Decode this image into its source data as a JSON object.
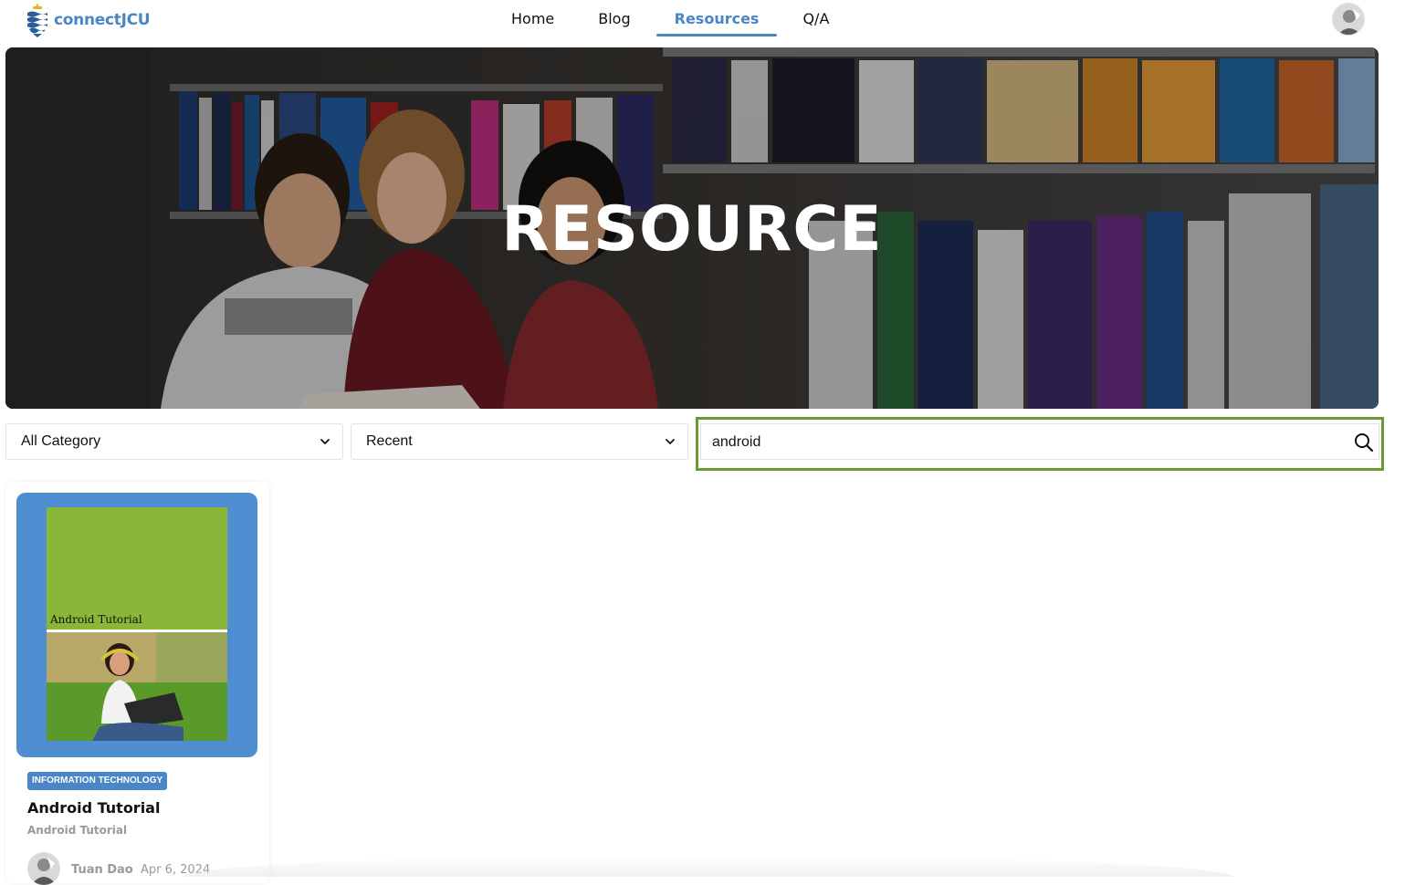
{
  "brand": {
    "name": "connectJCU",
    "color": "#4a86c5"
  },
  "nav": {
    "items": [
      {
        "label": "Home",
        "active": false
      },
      {
        "label": "Blog",
        "active": false
      },
      {
        "label": "Resources",
        "active": true
      },
      {
        "label": "Q/A",
        "active": false
      }
    ]
  },
  "hero": {
    "title": "RESOURCE"
  },
  "filters": {
    "category": {
      "selected": "All Category"
    },
    "sort": {
      "selected": "Recent"
    },
    "search": {
      "value": "android",
      "placeholder": ""
    },
    "highlight_color": "#6b9a34"
  },
  "resources": [
    {
      "cover_text": "Android Tutorial",
      "category": "INFORMATION TECHNOLOGY",
      "title": "Android Tutorial",
      "subtitle": "Android Tutorial",
      "author": "Tuan Dao",
      "date": "Apr 6, 2024",
      "cover_bg": "#4f8fd1",
      "cover_accent": "#8ab63a"
    }
  ]
}
